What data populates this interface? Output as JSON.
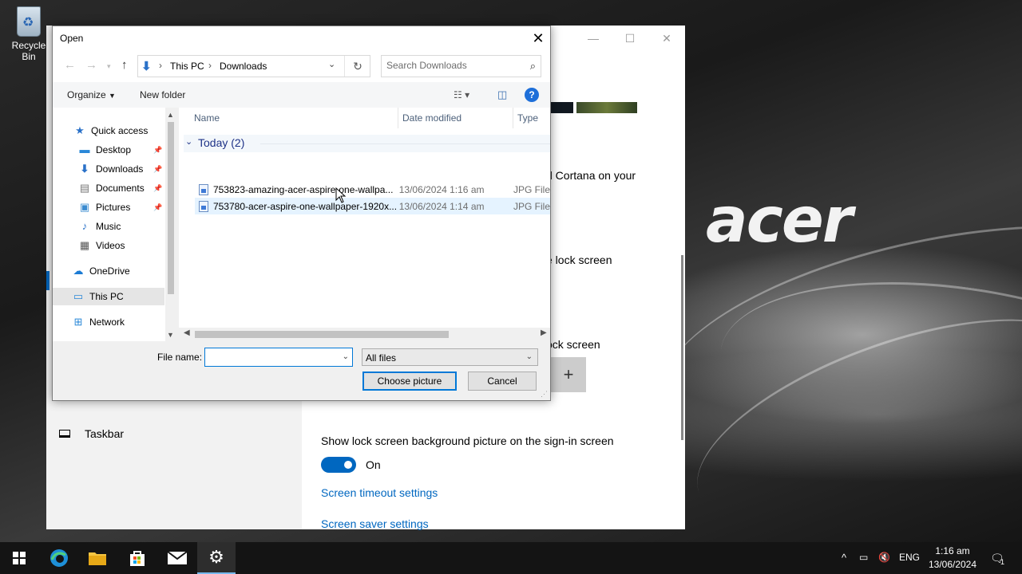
{
  "desktop": {
    "recycle_bin_label": "Recycle Bin",
    "brand_text": "acer"
  },
  "settings_window": {
    "text_cortana": "d Cortana on your",
    "text_lock_screen_1": "e lock screen",
    "text_lock_screen_2": "ock screen",
    "plus_label": "+",
    "sidebar_taskbar": "Taskbar",
    "show_bg_label": "Show lock screen background picture on the sign-in screen",
    "toggle_state": "On",
    "link_timeout": "Screen timeout settings",
    "link_saver": "Screen saver settings"
  },
  "dialog": {
    "title": "Open",
    "breadcrumb": [
      "This PC",
      "Downloads"
    ],
    "search_placeholder": "Search Downloads",
    "organize_label": "Organize",
    "new_folder_label": "New folder",
    "help_label": "?",
    "nav_items": [
      {
        "label": "Quick access",
        "icon": "star-icon",
        "pinned": false
      },
      {
        "label": "Desktop",
        "icon": "desktop-icon",
        "pinned": true
      },
      {
        "label": "Downloads",
        "icon": "download-icon",
        "pinned": true
      },
      {
        "label": "Documents",
        "icon": "documents-icon",
        "pinned": true
      },
      {
        "label": "Pictures",
        "icon": "pictures-icon",
        "pinned": true
      },
      {
        "label": "Music",
        "icon": "music-icon",
        "pinned": false
      },
      {
        "label": "Videos",
        "icon": "videos-icon",
        "pinned": false
      },
      {
        "label": "OneDrive",
        "icon": "cloud-icon",
        "pinned": false
      },
      {
        "label": "This PC",
        "icon": "computer-icon",
        "pinned": false,
        "selected": true
      },
      {
        "label": "Network",
        "icon": "network-icon",
        "pinned": false
      }
    ],
    "columns": [
      "Name",
      "Date modified",
      "Type"
    ],
    "group_label": "Today (2)",
    "files": [
      {
        "name": "753823-amazing-acer-aspire-one-wallpa...",
        "date": "13/06/2024 1:16 am",
        "type": "JPG File"
      },
      {
        "name": "753780-acer-aspire-one-wallpaper-1920x...",
        "date": "13/06/2024 1:14 am",
        "type": "JPG File"
      }
    ],
    "file_name_label": "File name:",
    "file_name_value": "",
    "filter_value": "All files",
    "choose_button": "Choose picture",
    "cancel_button": "Cancel"
  },
  "taskbar": {
    "language": "ENG",
    "time": "1:16 am",
    "date": "13/06/2024",
    "notification_count": "1"
  }
}
